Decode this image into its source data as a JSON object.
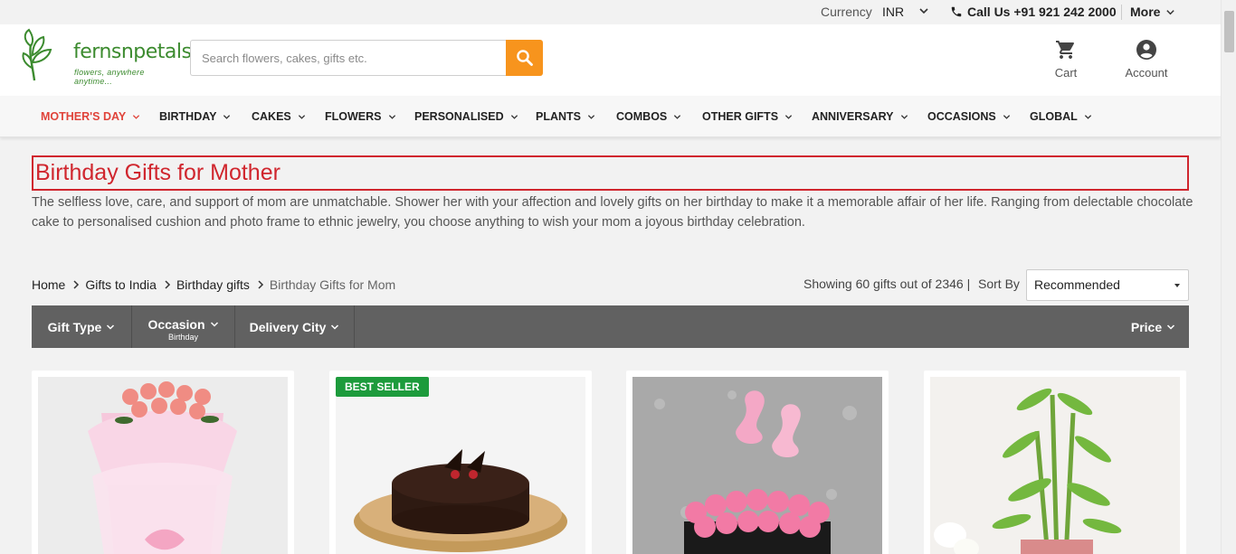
{
  "topbar": {
    "currency_label": "Currency",
    "currency_value": "INR",
    "call_label": "Call Us +91 921 242 2000",
    "more_label": "More"
  },
  "header": {
    "logo_text": "fernsnpetals",
    "logo_tagline": "flowers, anywhere anytime...",
    "search_placeholder": "Search flowers, cakes, gifts etc.",
    "cart_label": "Cart",
    "account_label": "Account"
  },
  "nav": {
    "items": [
      {
        "label": "MOTHER'S DAY"
      },
      {
        "label": "BIRTHDAY"
      },
      {
        "label": "CAKES"
      },
      {
        "label": "FLOWERS"
      },
      {
        "label": "PERSONALISED"
      },
      {
        "label": "PLANTS"
      },
      {
        "label": "COMBOS"
      },
      {
        "label": "OTHER GIFTS"
      },
      {
        "label": "ANNIVERSARY"
      },
      {
        "label": "OCCASIONS"
      },
      {
        "label": "GLOBAL"
      }
    ]
  },
  "page": {
    "title": "Birthday Gifts for Mother",
    "description": "The selfless love, care, and support of mom are unmatchable. Shower her with your affection and lovely gifts on her birthday to make it a memorable affair of her life. Ranging from delectable chocolate cake to personalised cushion and photo frame to ethnic jewelry, you choose anything to wish your mom a joyous birthday celebration."
  },
  "breadcrumb": [
    "Home",
    "Gifts to India",
    "Birthday gifts",
    "Birthday Gifts for Mom"
  ],
  "listing": {
    "showing": "Showing 60 gifts out of 2346 |",
    "sort_label": "Sort By",
    "sort_value": "Recommended"
  },
  "filters": {
    "gift_type": "Gift Type",
    "occasion": "Occasion",
    "occasion_sub": "Birthday",
    "delivery_city": "Delivery City",
    "price": "Price"
  },
  "products": [
    {
      "badge": ""
    },
    {
      "badge": "BEST SELLER"
    },
    {
      "badge": ""
    },
    {
      "badge": ""
    }
  ],
  "colors": {
    "accent_orange": "#f7941d",
    "title_red": "#d0262e",
    "nav_active": "#e0433a",
    "filterbar": "#616161",
    "badge_green": "#1d9b3c",
    "brand_green": "#3c8b2f"
  }
}
